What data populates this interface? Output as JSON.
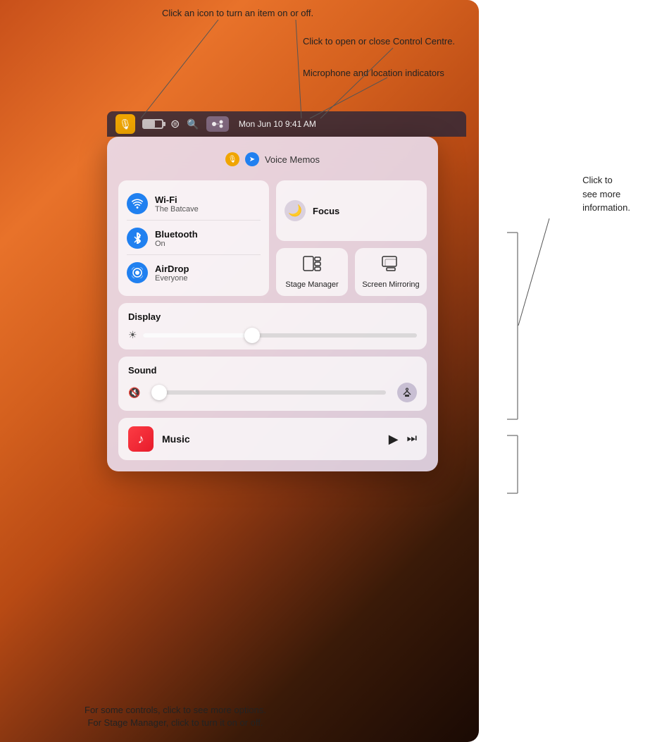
{
  "annotations": {
    "turn_on_off": "Click an icon to turn an item on or off.",
    "open_close_cc": "Click to open or close Control Centre.",
    "mic_location": "Microphone and location indicators",
    "see_more": "Click to\nsee more\ninformation.",
    "bottom_note1": "For some controls, click to see more options.",
    "bottom_note2": "For Stage Manager, click to turn it on or off."
  },
  "menubar": {
    "time": "Mon Jun 10  9:41 AM"
  },
  "control_centre": {
    "voice_memos_label": "Voice Memos",
    "wifi": {
      "title": "Wi-Fi",
      "subtitle": "The Batcave"
    },
    "bluetooth": {
      "title": "Bluetooth",
      "subtitle": "On"
    },
    "airdrop": {
      "title": "AirDrop",
      "subtitle": "Everyone"
    },
    "focus": {
      "label": "Focus"
    },
    "stage_manager": {
      "label": "Stage\nManager"
    },
    "screen_mirroring": {
      "label": "Screen\nMirroring"
    },
    "display": {
      "title": "Display",
      "slider_pct": 40
    },
    "sound": {
      "title": "Sound",
      "slider_pct": 0
    },
    "music": {
      "label": "Music"
    }
  }
}
